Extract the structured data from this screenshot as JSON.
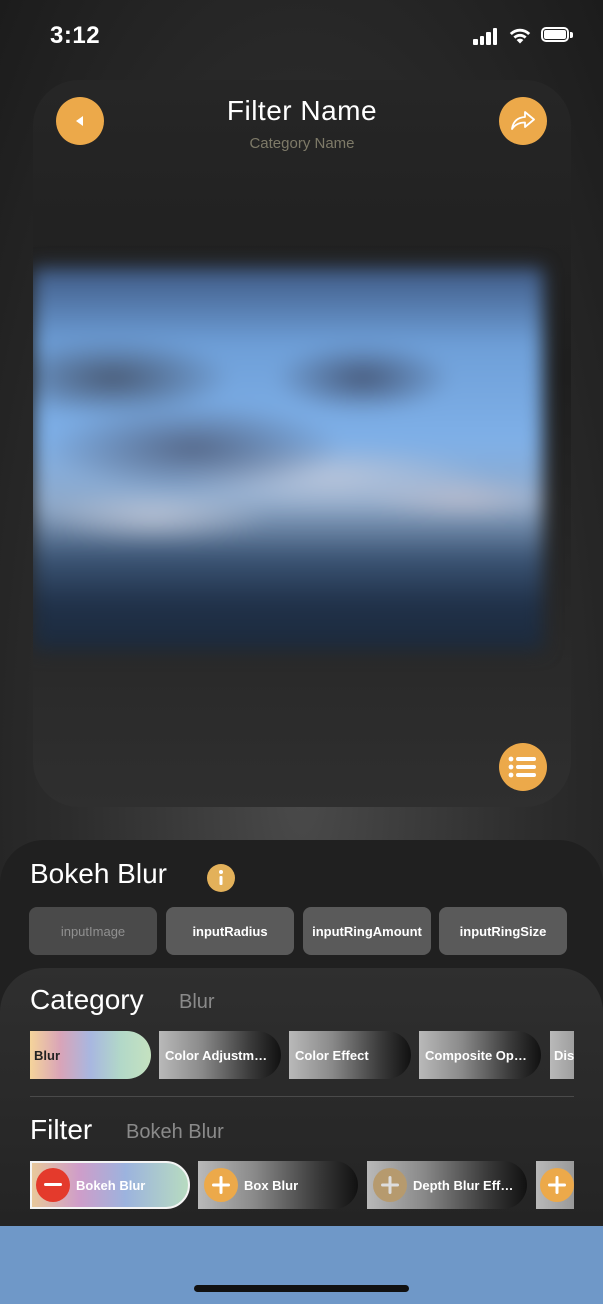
{
  "status_bar": {
    "time": "3:12"
  },
  "preview": {
    "title": "Filter Name",
    "subtitle": "Category Name"
  },
  "filter_details": {
    "name": "Bokeh Blur",
    "params": [
      "inputImage",
      "inputRadius",
      "inputRingAmount",
      "inputRingSize"
    ]
  },
  "category": {
    "label": "Category",
    "selected": "Blur",
    "chips": [
      "Blur",
      "Color Adjustm…",
      "Color Effect",
      "Composite Op…",
      "Dis"
    ]
  },
  "filter": {
    "label": "Filter",
    "selected": "Bokeh Blur",
    "chips": [
      "Bokeh Blur",
      "Box Blur",
      "Depth Blur Eff…",
      ""
    ]
  },
  "colors": {
    "accent": "#eca94a",
    "remove": "#e43a2c",
    "home_area": "#6f98c8"
  }
}
